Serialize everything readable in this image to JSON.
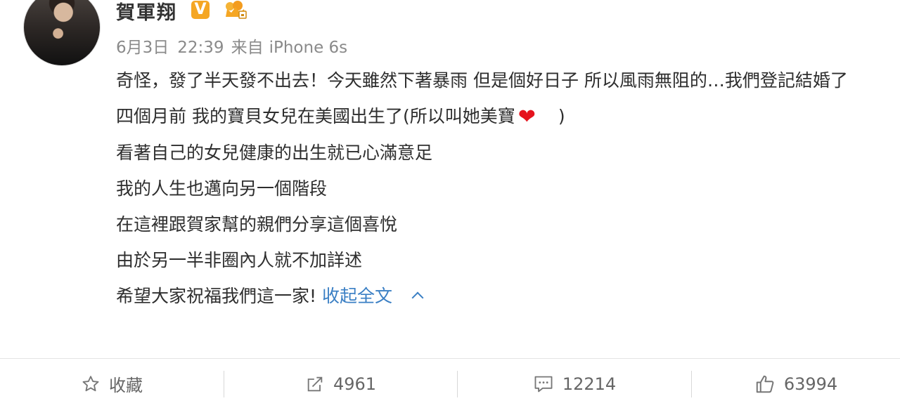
{
  "post": {
    "username": "賀軍翔",
    "vip_badge": "V",
    "date": "6月3日",
    "time": "22:39",
    "source_prefix": "来自",
    "device": "iPhone 6s",
    "lines": [
      "奇怪，發了半天發不出去！今天雖然下著暴雨 但是個好日子 所以風雨無阻的…我們登記結婚了",
      "四個月前 我的寶貝女兒在美國出生了(所以叫她美寶",
      "看著自己的女兒健康的出生就已心滿意足",
      "我的人生也邁向另一個階段",
      "在這裡跟賀家幫的親們分享這個喜悅",
      "由於另一半非圈內人就不加詳述",
      "希望大家祝福我們這一家!"
    ],
    "heart_emoji": "❤",
    "closing_paren": ")",
    "collapse_label": "收起全文"
  },
  "actions": {
    "favorite_label": "收藏",
    "repost_count": "4961",
    "comment_count": "12214",
    "like_count": "63994"
  },
  "colors": {
    "link": "#3a7fc4",
    "vip": "#f5a623",
    "heart": "#e5131d"
  },
  "icons": [
    "star-icon",
    "repost-icon",
    "comment-icon",
    "thumbs-up-icon",
    "chevron-up-icon",
    "crown-badge-icon"
  ]
}
